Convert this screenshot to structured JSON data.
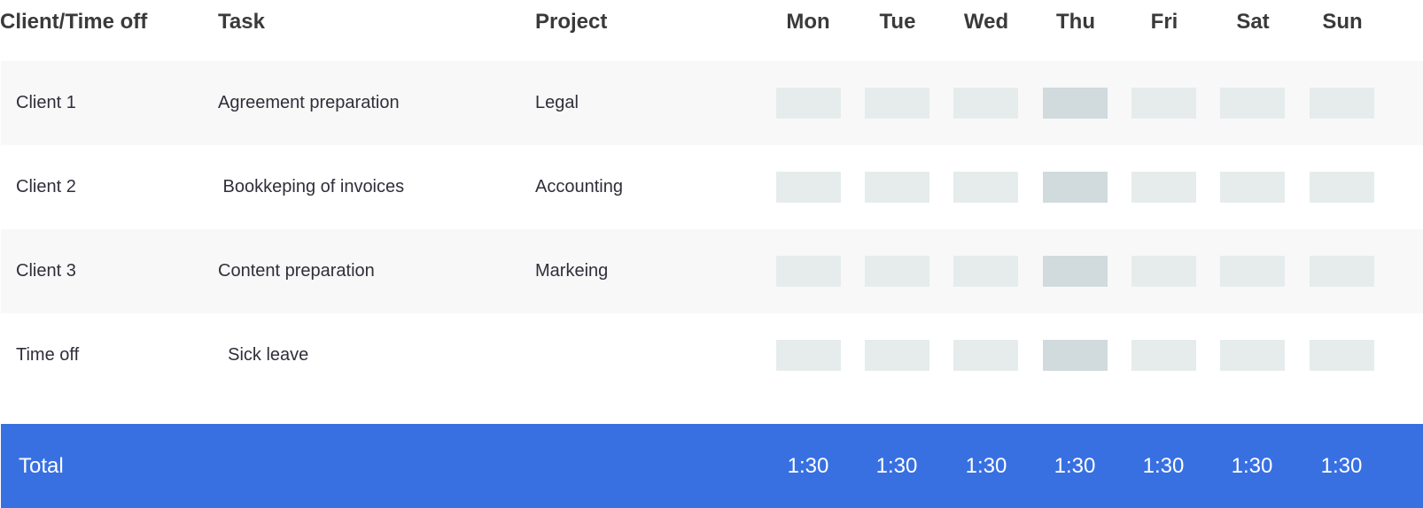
{
  "header": {
    "client": "Client/Time off",
    "task": "Task",
    "project": "Project",
    "days": [
      "Mon",
      "Tue",
      "Wed",
      "Thu",
      "Fri",
      "Sat",
      "Sun"
    ]
  },
  "rows": [
    {
      "client": "Client 1",
      "task": "Agreement preparation",
      "project": "Legal"
    },
    {
      "client": "Client 2",
      "task": " Bookkeping of invoices",
      "project": "Accounting"
    },
    {
      "client": "Client 3",
      "task": "Content preparation",
      "project": "Markeing"
    },
    {
      "client": "Time off",
      "task": "  Sick leave",
      "project": ""
    }
  ],
  "total": {
    "label": "Total",
    "values": [
      "1:30",
      "1:30",
      "1:30",
      "1:30",
      "1:30",
      "1:30",
      "1:30"
    ]
  },
  "colors": {
    "accent": "#3870e2",
    "slot": "#e6ecec",
    "slot_highlight": "#d1dadd",
    "row_alt": "#f8f8f8"
  }
}
